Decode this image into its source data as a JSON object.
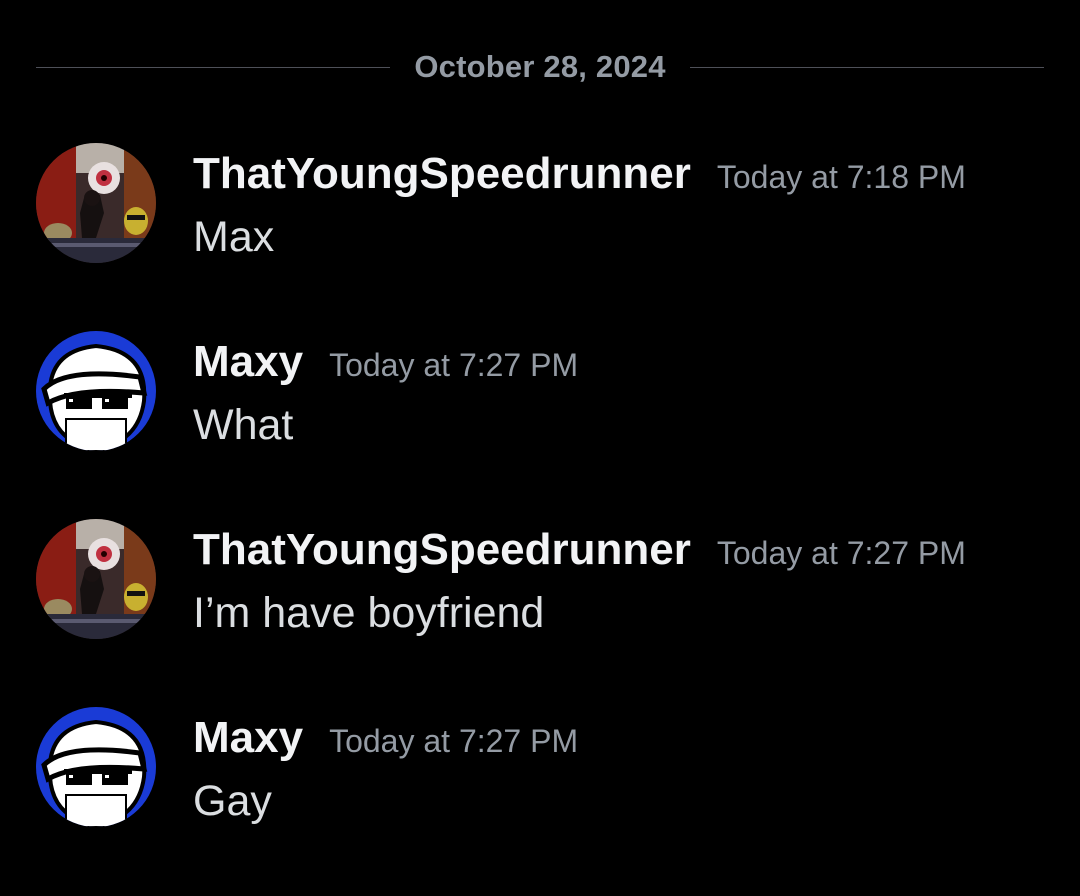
{
  "divider": {
    "date": "October 28, 2024"
  },
  "messages": [
    {
      "username": "ThatYoungSpeedrunner",
      "timestamp": "Today at 7:18 PM",
      "content": "Max",
      "avatar_icon": "collage-avatar-icon"
    },
    {
      "username": "Maxy",
      "timestamp": "Today at 7:27 PM",
      "content": "What",
      "avatar_icon": "kettle-sunglasses-avatar-icon",
      "avatar_label": "kettle"
    },
    {
      "username": "ThatYoungSpeedrunner",
      "timestamp": "Today at 7:27 PM",
      "content": "I’m have boyfriend",
      "avatar_icon": "collage-avatar-icon"
    },
    {
      "username": "Maxy",
      "timestamp": "Today at 7:27 PM",
      "content": "Gay",
      "avatar_icon": "kettle-sunglasses-avatar-icon",
      "avatar_label": "kettle"
    }
  ],
  "colors": {
    "background": "#000000",
    "username": "#f2f3f5",
    "timestamp": "#949ba4",
    "content": "#dbdee1",
    "divider_line": "#4e5058",
    "maxy_avatar_ring": "#1a3bd6"
  }
}
